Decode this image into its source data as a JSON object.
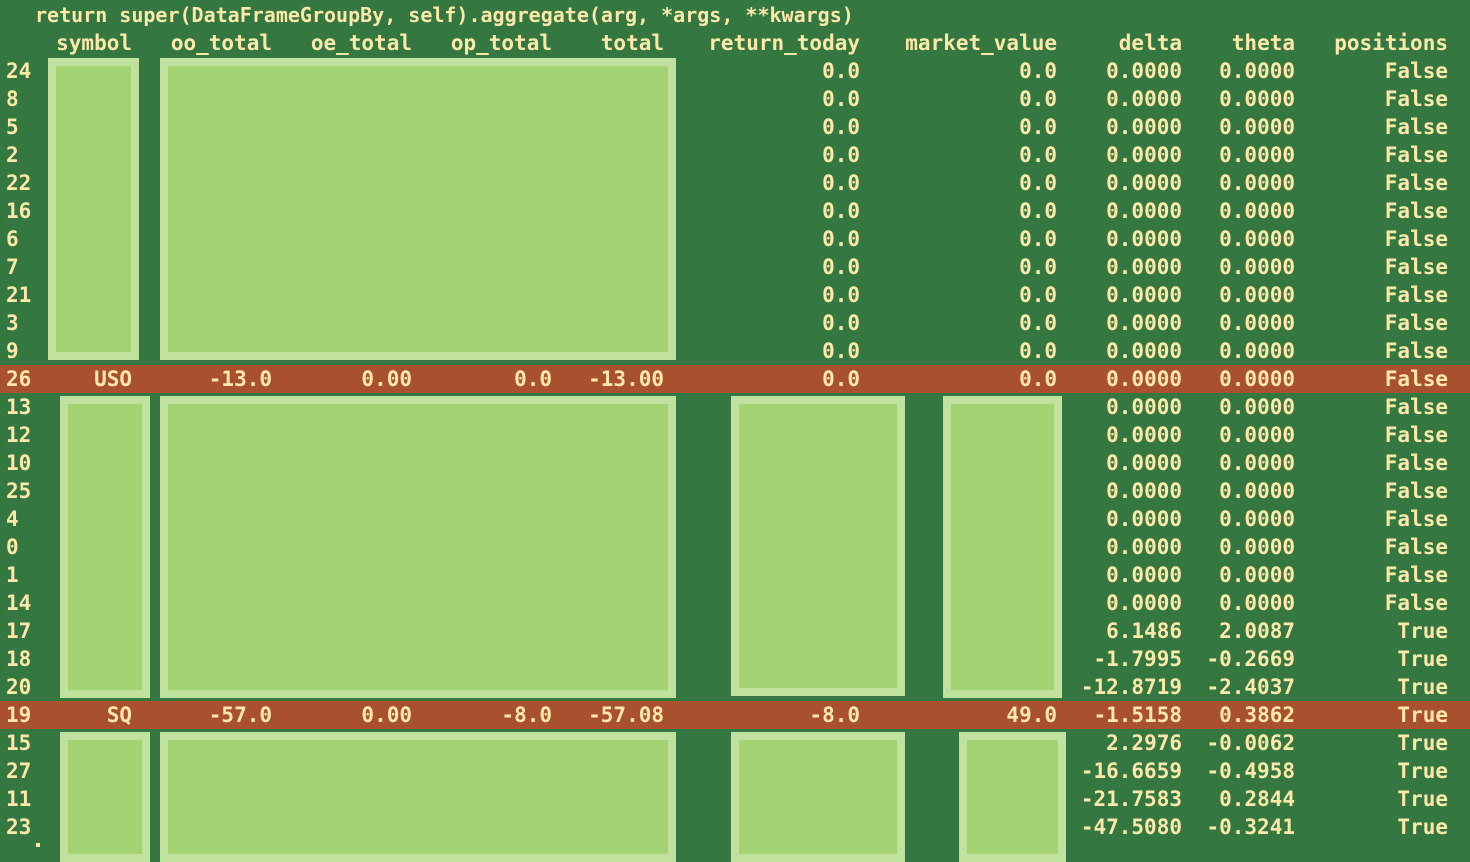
{
  "code_line": "return super(DataFrameGroupBy, self).aggregate(arg, *args, **kwargs)",
  "columns": {
    "symbol": "symbol",
    "oo_total": "oo_total",
    "oe_total": "oe_total",
    "op_total": "op_total",
    "total": "total",
    "return_today": "return_today",
    "market_value": "market_value",
    "delta": "delta",
    "theta": "theta",
    "positions": "positions"
  },
  "rows": [
    {
      "idx": "24",
      "ret": "0.0",
      "mv": "0.0",
      "delta": "0.0000",
      "theta": "0.0000",
      "pos": "False"
    },
    {
      "idx": "8",
      "ret": "0.0",
      "mv": "0.0",
      "delta": "0.0000",
      "theta": "0.0000",
      "pos": "False"
    },
    {
      "idx": "5",
      "ret": "0.0",
      "mv": "0.0",
      "delta": "0.0000",
      "theta": "0.0000",
      "pos": "False"
    },
    {
      "idx": "2",
      "ret": "0.0",
      "mv": "0.0",
      "delta": "0.0000",
      "theta": "0.0000",
      "pos": "False"
    },
    {
      "idx": "22",
      "ret": "0.0",
      "mv": "0.0",
      "delta": "0.0000",
      "theta": "0.0000",
      "pos": "False"
    },
    {
      "idx": "16",
      "ret": "0.0",
      "mv": "0.0",
      "delta": "0.0000",
      "theta": "0.0000",
      "pos": "False"
    },
    {
      "idx": "6",
      "ret": "0.0",
      "mv": "0.0",
      "delta": "0.0000",
      "theta": "0.0000",
      "pos": "False"
    },
    {
      "idx": "7",
      "ret": "0.0",
      "mv": "0.0",
      "delta": "0.0000",
      "theta": "0.0000",
      "pos": "False"
    },
    {
      "idx": "21",
      "ret": "0.0",
      "mv": "0.0",
      "delta": "0.0000",
      "theta": "0.0000",
      "pos": "False"
    },
    {
      "idx": "3",
      "ret": "0.0",
      "mv": "0.0",
      "delta": "0.0000",
      "theta": "0.0000",
      "pos": "False"
    },
    {
      "idx": "9",
      "ret": "0.0",
      "mv": "0.0",
      "delta": "0.0000",
      "theta": "0.0000",
      "pos": "False"
    },
    {
      "idx": "26",
      "symbol": "USO",
      "oo": "-13.0",
      "oe": "0.00",
      "op": "0.0",
      "total": "-13.00",
      "ret": "0.0",
      "mv": "0.0",
      "delta": "0.0000",
      "theta": "0.0000",
      "pos": "False",
      "highlight": true
    },
    {
      "idx": "13",
      "delta": "0.0000",
      "theta": "0.0000",
      "pos": "False"
    },
    {
      "idx": "12",
      "delta": "0.0000",
      "theta": "0.0000",
      "pos": "False"
    },
    {
      "idx": "10",
      "delta": "0.0000",
      "theta": "0.0000",
      "pos": "False"
    },
    {
      "idx": "25",
      "delta": "0.0000",
      "theta": "0.0000",
      "pos": "False"
    },
    {
      "idx": "4",
      "delta": "0.0000",
      "theta": "0.0000",
      "pos": "False"
    },
    {
      "idx": "0",
      "delta": "0.0000",
      "theta": "0.0000",
      "pos": "False"
    },
    {
      "idx": "1",
      "delta": "0.0000",
      "theta": "0.0000",
      "pos": "False"
    },
    {
      "idx": "14",
      "delta": "0.0000",
      "theta": "0.0000",
      "pos": "False"
    },
    {
      "idx": "17",
      "delta": "6.1486",
      "theta": "2.0087",
      "pos": "True"
    },
    {
      "idx": "18",
      "delta": "-1.7995",
      "theta": "-0.2669",
      "pos": "True"
    },
    {
      "idx": "20",
      "delta": "-12.8719",
      "theta": "-2.4037",
      "pos": "True"
    },
    {
      "idx": "19",
      "symbol": "SQ",
      "oo": "-57.0",
      "oe": "0.00",
      "op": "-8.0",
      "total": "-57.08",
      "ret": "-8.0",
      "mv": "49.0",
      "delta": "-1.5158",
      "theta": "0.3862",
      "pos": "True",
      "highlight": true
    },
    {
      "idx": "15",
      "delta": "2.2976",
      "theta": "-0.0062",
      "pos": "True"
    },
    {
      "idx": "27",
      "delta": "-16.6659",
      "theta": "-0.4958",
      "pos": "True"
    },
    {
      "idx": "11",
      "delta": "-21.7583",
      "theta": "0.2844",
      "pos": "True"
    },
    {
      "idx": "23",
      "delta": "-47.5080",
      "theta": "-0.3241",
      "pos": "True"
    }
  ],
  "colors": {
    "background": "#357740",
    "text": "#fce9a9",
    "highlight_row": "#a9502f",
    "redaction_fill": "#a3d373",
    "redaction_border": "#c1e29e"
  }
}
